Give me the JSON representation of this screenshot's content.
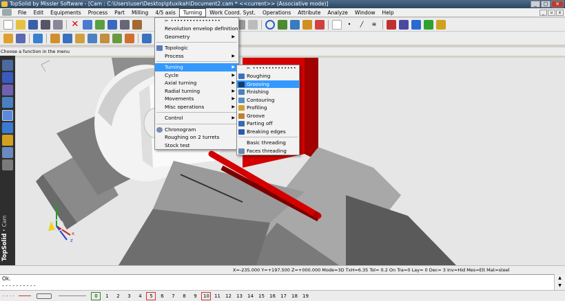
{
  "window": {
    "title": "TopSolid by Missler Software - [Cam : C:\\Users\\user\\Desktop\\ptuxikah\\Document2.cam *  <<current>> (Associative mode)]"
  },
  "menubar": [
    "File",
    "Edit",
    "Equipments",
    "Process",
    "Part",
    "Milling",
    "4/5 axis",
    "Turning",
    "Work Coord. Syst.",
    "Operations",
    "Attribute",
    "Analyze",
    "Window",
    "Help"
  ],
  "status": {
    "prompt": "Choose a function in the menu"
  },
  "leftbar": {
    "brand": "TopSolid",
    "module": "Cam"
  },
  "turning_menu": {
    "tearoff": "✂ ••••••••••••••••",
    "revolution": "Revolution envelop definition",
    "geometry": "Geometry",
    "topologic": "Topologic",
    "process": "Process",
    "turning": "Turning",
    "cycle": "Cycle",
    "axial": "Axial turning",
    "radial": "Radial turning",
    "movements": "Movements",
    "misc": "Misc operations",
    "control": "Control",
    "chronogram": "Chronogram",
    "roughing2": "Roughing on 2 turrets",
    "stocktest": "Stock test"
  },
  "submenu": {
    "tearoff": "✂ ••••••••••••••",
    "roughing": "Roughing",
    "grooving": "Grooving",
    "finishing": "Finishing",
    "contouring": "Contouring",
    "profiling": "Profiling",
    "groove": "Groove",
    "partingoff": "Parting off",
    "breaking": "Breaking edges",
    "basicthreading": "Basic threading",
    "facesthreading": "Faces threading"
  },
  "coords": {
    "text": "X=-235.000   Y=+197.500   Z=+000.000   Mode=3D   TxH=6.35    Tol=   0.2    On   Tra=0    Lay=   0    Dec= 3    Inv=Hid   Mes=Elt   Mat=steel"
  },
  "messages": {
    "line1": "Ok.",
    "line2": "- - - - - - - - - -"
  },
  "layers": [
    "0",
    "1",
    "2",
    "3",
    "4",
    "5",
    "6",
    "7",
    "8",
    "9",
    "10",
    "11",
    "12",
    "13",
    "14",
    "15",
    "16",
    "17",
    "18",
    "19"
  ],
  "triad": {
    "y": "y",
    "x": "x",
    "z": "z"
  },
  "colors": {
    "highlight": "#3399ff",
    "titlebar": "#2c4660",
    "part_red": "#d40000"
  }
}
